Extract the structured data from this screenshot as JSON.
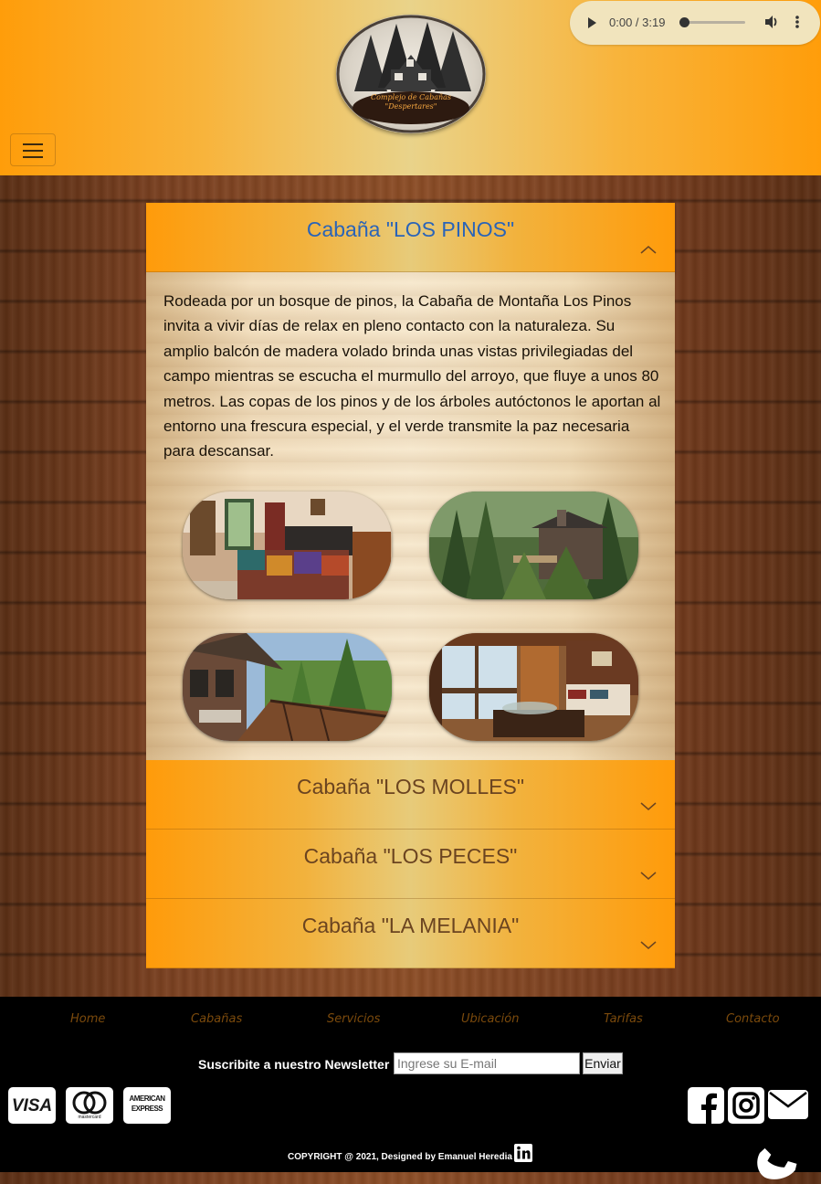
{
  "audio": {
    "time": "0:00 / 3:19",
    "progress": 0
  },
  "logo": {
    "line1": "Complejo de Cabañas",
    "line2": "\"Despertares\""
  },
  "accordion": [
    {
      "title": "Cabaña \"LOS PINOS\"",
      "expanded": true,
      "description": "Rodeada por un bosque de pinos, la Cabaña de Montaña Los Pinos invita a vivir días de relax en pleno contacto con la naturaleza. Su amplio balcón de madera volado brinda unas vistas privilegiadas del campo mientras se escucha el murmullo del arroyo, que fluye a unos 80 metros. Las copas de los pinos y de los árboles autóctonos le aportan al entorno una frescura especial, y el verde transmite la paz necesaria para descansar."
    },
    {
      "title": "Cabaña \"LOS MOLLES\"",
      "expanded": false
    },
    {
      "title": "Cabaña \"LOS PECES\"",
      "expanded": false
    },
    {
      "title": "Cabaña \"LA MELANIA\"",
      "expanded": false
    }
  ],
  "footer": {
    "nav": [
      "Home",
      "Cabañas",
      "Servicios",
      "Ubicación",
      "Tarifas",
      "Contacto"
    ],
    "newsletter_label": "Suscribite a nuestro Newsletter",
    "email_placeholder": "Ingrese su E-mail",
    "send_label": "Enviar",
    "cards": {
      "visa": "VISA",
      "mastercard": "mastercard",
      "amex_line1": "AMERICAN",
      "amex_line2": "EXPRESS"
    },
    "copyright": "COPYRIGHT @ 2021, Designed by Emanuel Heredia"
  },
  "icons": [
    "hamburger-icon",
    "play-icon",
    "volume-icon",
    "more-vert-icon",
    "chevron-up-icon",
    "chevron-down-icon",
    "facebook-icon",
    "instagram-icon",
    "email-icon",
    "phone-icon",
    "linkedin-icon"
  ],
  "colors": {
    "header_orange": "#ff9d0a",
    "active_title": "#2a64b8",
    "title_brown": "#6b4420",
    "footer_bg": "#000000",
    "nav_text": "#7b4a0c"
  }
}
